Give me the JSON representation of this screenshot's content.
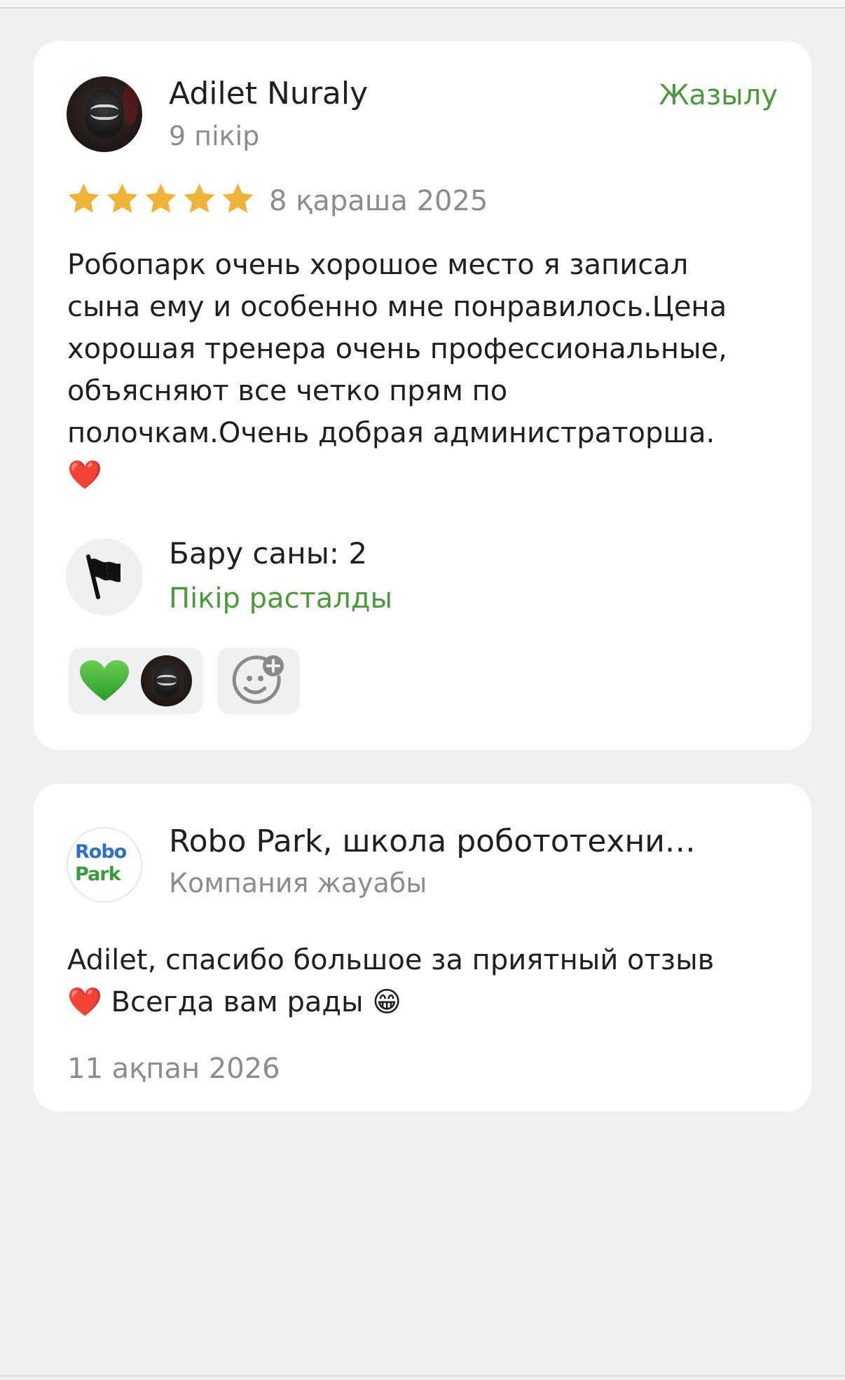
{
  "review": {
    "author_name": "Adilet Nuraly",
    "author_reviews": "9 пікір",
    "subscribe_label": "Жазылу",
    "rating": 5,
    "rating_max": 5,
    "star_color": "#f0b33a",
    "date": "8 қараша 2025",
    "text": "Робопарк очень хорошое место я записал\nсына ему и особенно мне понравилось.Цена\nхорошая тренера очень профессиональные,\nобъясняют все четко прям по\nполочкам.Очень добрая администраторша.\n❤️",
    "visits_label": "Бару саны: 2",
    "show_reply_label": "Пікір расталды",
    "reactions": [
      {
        "icon": "green-heart-icon",
        "color": "#3aa13a"
      }
    ],
    "icons": {
      "flag": "flag-icon",
      "add_reaction": "add-reaction-icon"
    }
  },
  "reply": {
    "company_logo_line1": "Robo",
    "company_logo_line2": "Park",
    "company_name": "Robo Park, школа робототехни…",
    "company_sub": "Компания жауабы",
    "text": "Adilet, спасибо большое за приятный отзыв\n❤️ Всегда вам рады 😁",
    "date": "11 ақпан 2026"
  },
  "colors": {
    "accent_green": "#4a9a3a",
    "secondary_text": "#8c8c8c",
    "background": "#f0f0f0"
  }
}
